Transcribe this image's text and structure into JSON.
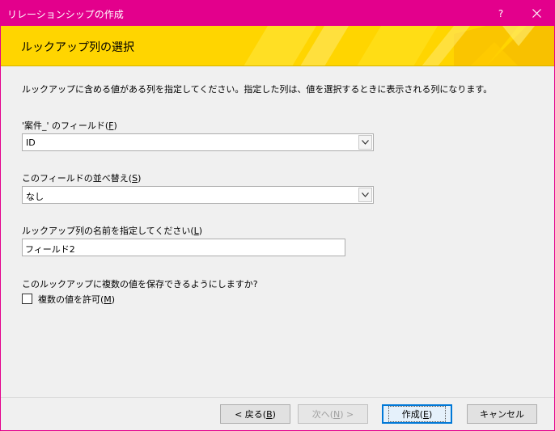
{
  "window": {
    "title": "リレーションシップの作成",
    "help_label": "?",
    "accent_color": "#e3008c"
  },
  "banner": {
    "title": "ルックアップ列の選択",
    "color": "#ffd500"
  },
  "instruction": "ルックアップに含める値がある列を指定してください。指定した列は、値を選択するときに表示される列になります。",
  "field": {
    "label_pre": "'案件_' のフィールド(",
    "label_key": "F",
    "label_post": ")",
    "value": "ID"
  },
  "sort": {
    "label_pre": "このフィールドの並べ替え(",
    "label_key": "S",
    "label_post": ")",
    "value": "なし"
  },
  "lookup_name": {
    "label_pre": "ルックアップ列の名前を指定してください(",
    "label_key": "L",
    "label_post": ")",
    "value": "フィールド2"
  },
  "multi": {
    "question": "このルックアップに複数の値を保存できるようにしますか?",
    "checkbox_pre": "複数の値を許可(",
    "checkbox_key": "M",
    "checkbox_post": ")",
    "checked": false
  },
  "buttons": {
    "back_pre": "< 戻る(",
    "back_key": "B",
    "back_post": ")",
    "next_pre": "次へ(",
    "next_key": "N",
    "next_post": ") >",
    "create_pre": "作成(",
    "create_key": "E",
    "create_post": ")",
    "cancel": "キャンセル"
  }
}
